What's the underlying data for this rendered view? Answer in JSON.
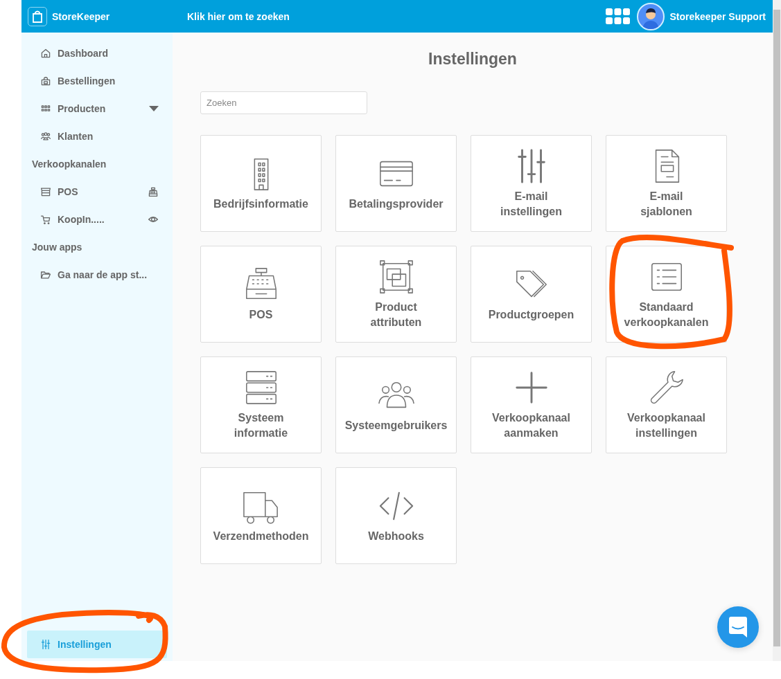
{
  "header": {
    "brand": "StoreKeeper",
    "search_prompt": "Klik hier om te zoeken",
    "user_name": "Storekeeper Support"
  },
  "sidebar": {
    "items": [
      {
        "kind": "home",
        "label": "Dashboard",
        "selected": false
      },
      {
        "kind": "bag",
        "label": "Bestellingen",
        "selected": false
      },
      {
        "kind": "grid",
        "label": "Producten",
        "selected": false,
        "expanded": false
      },
      {
        "kind": "users",
        "label": "Klanten",
        "selected": false
      },
      {
        "kind": "heading",
        "label": "Verkoopkanalen"
      },
      {
        "kind": "store",
        "label": "POS",
        "selected": false,
        "action": {
          "kind": "register"
        }
      },
      {
        "kind": "cart",
        "label": "KoopIn.....",
        "selected": false,
        "action": {
          "kind": "eye"
        }
      },
      {
        "kind": "heading",
        "label": "Jouw apps"
      },
      {
        "kind": "folder",
        "label": "Ga naar de app st...",
        "selected": false
      }
    ],
    "footer_item": {
      "kind": "sliders",
      "label": "Instellingen",
      "selected": true
    }
  },
  "main": {
    "title": "Instellingen",
    "search": {
      "placeholder": "Zoeken"
    },
    "tiles": [
      {
        "kind": "building",
        "label": "Bedrijfsinformatie"
      },
      {
        "kind": "card",
        "label": "Betalingsprovider"
      },
      {
        "kind": "sliders",
        "label": "E-mail instellingen"
      },
      {
        "kind": "document",
        "label": "E-mail sjablonen"
      },
      {
        "kind": "register",
        "label": "POS"
      },
      {
        "kind": "shapes",
        "label": "Product attributen"
      },
      {
        "kind": "tags",
        "label": "Productgroepen"
      },
      {
        "kind": "list",
        "label": "Standaard verkoopkanalen"
      },
      {
        "kind": "server",
        "label": "Systeem informatie"
      },
      {
        "kind": "users",
        "label": "Systeemgebruikers"
      },
      {
        "kind": "plus",
        "label": "Verkoopkanaal aanmaken"
      },
      {
        "kind": "wrench",
        "label": "Verkoopkanaal instellingen"
      },
      {
        "kind": "truck",
        "label": "Verzendmethoden"
      },
      {
        "kind": "code",
        "label": "Webhooks"
      }
    ]
  }
}
